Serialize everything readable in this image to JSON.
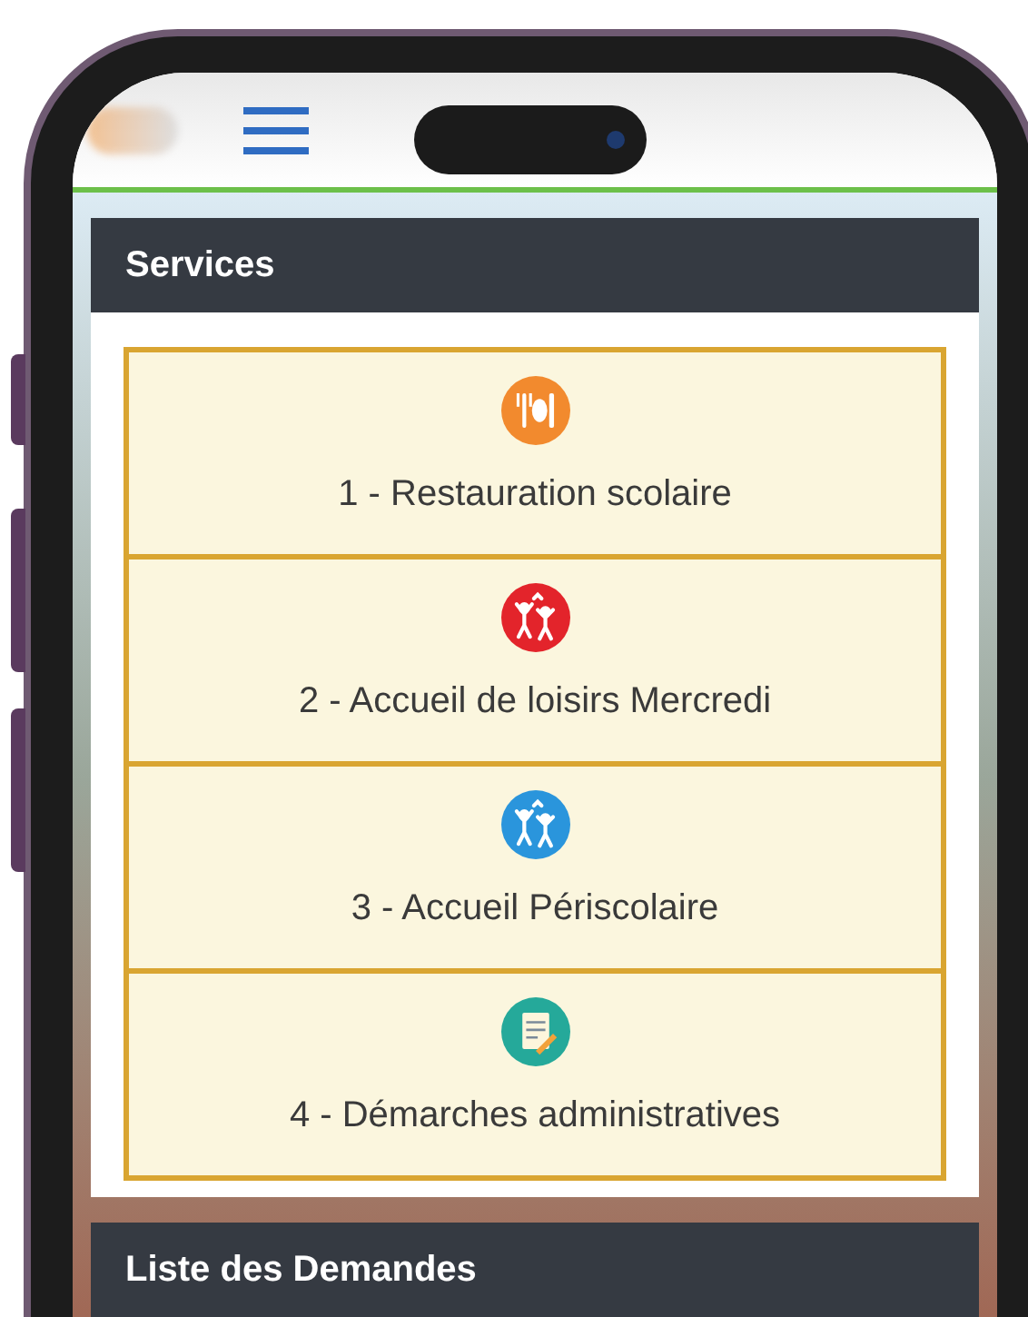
{
  "sections": [
    {
      "title": "Services",
      "items": [
        {
          "label": "1 - Restauration scolaire",
          "kind": "dining",
          "color": "#f28a2e"
        },
        {
          "label": "2 - Accueil de loisirs Mercredi",
          "kind": "kids",
          "color": "#e3242b"
        },
        {
          "label": "3 - Accueil Périscolaire",
          "kind": "kids",
          "color": "#2a95dc"
        },
        {
          "label": "4 - Démarches administratives",
          "kind": "form",
          "color": "#25a99a"
        }
      ]
    },
    {
      "title": "Liste des Demandes"
    }
  ]
}
